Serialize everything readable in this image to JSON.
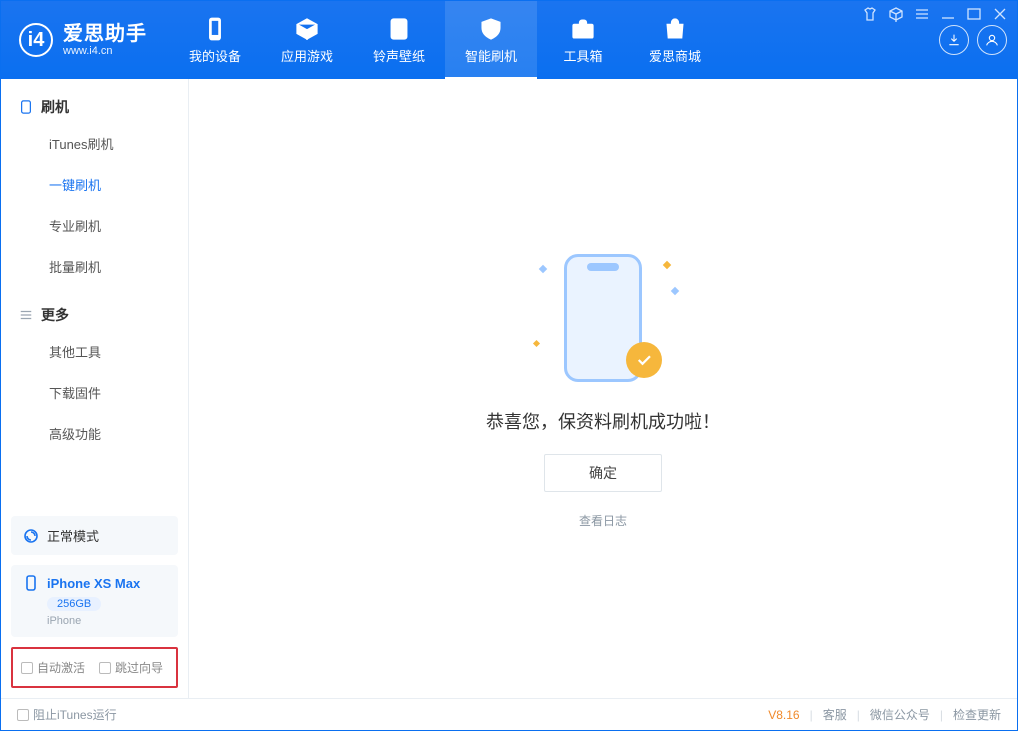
{
  "app": {
    "name": "爱思助手",
    "url": "www.i4.cn"
  },
  "nav": {
    "items": [
      {
        "label": "我的设备"
      },
      {
        "label": "应用游戏"
      },
      {
        "label": "铃声壁纸"
      },
      {
        "label": "智能刷机"
      },
      {
        "label": "工具箱"
      },
      {
        "label": "爱思商城"
      }
    ]
  },
  "sidebar": {
    "group1": {
      "title": "刷机",
      "items": [
        "iTunes刷机",
        "一键刷机",
        "专业刷机",
        "批量刷机"
      ],
      "activeIndex": 1
    },
    "group2": {
      "title": "更多",
      "items": [
        "其他工具",
        "下载固件",
        "高级功能"
      ]
    },
    "mode": {
      "label": "正常模式"
    },
    "device": {
      "name": "iPhone XS Max",
      "storage": "256GB",
      "type": "iPhone"
    },
    "checks": {
      "autoActivate": "自动激活",
      "skipGuide": "跳过向导"
    }
  },
  "main": {
    "message": "恭喜您，保资料刷机成功啦！",
    "okButton": "确定",
    "viewLog": "查看日志"
  },
  "footer": {
    "blockItunes": "阻止iTunes运行",
    "version": "V8.16",
    "links": [
      "客服",
      "微信公众号",
      "检查更新"
    ]
  }
}
